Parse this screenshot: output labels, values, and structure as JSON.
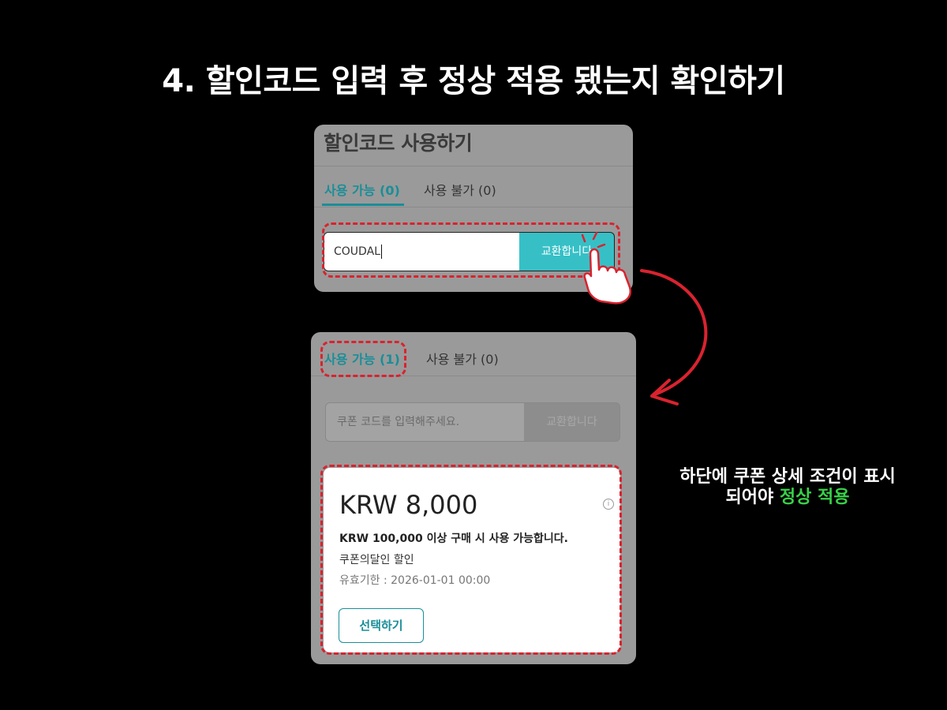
{
  "heading": "4. 할인코드 입력 후 정상 적용 됐는지 확인하기",
  "panel1": {
    "title": "할인코드 사용하기",
    "tab_available": "사용 가능 (0)",
    "tab_unavailable": "사용 불가 (0)",
    "code_value": "COUDAL",
    "exchange_label": "교환합니다"
  },
  "panel2": {
    "tab_available": "사용 가능 (1)",
    "tab_unavailable": "사용 불가 (0)",
    "input_placeholder": "쿠폰 코드를 입력해주세요.",
    "exchange_label": "교환합니다",
    "coupon": {
      "amount": "KRW 8,000",
      "info": "i",
      "condition": "KRW 100,000 이상 구매 시 사용 가능합니다.",
      "name": "쿠폰의달인 할인",
      "expiry": "유효기한 : 2026-01-01 00:00",
      "select_label": "선택하기"
    }
  },
  "caption": {
    "line1": "하단에 쿠폰 상세 조건이 표시",
    "line2_prefix": "되어야 ",
    "line2_highlight": "정상 적용"
  },
  "colors": {
    "accent_teal": "#1a8e98",
    "button_teal": "#36c0c6",
    "dash_red": "#d9232f",
    "caption_green": "#39d04a"
  },
  "icons": [
    "pointer-hand-icon",
    "curved-arrow-icon",
    "info-icon"
  ]
}
